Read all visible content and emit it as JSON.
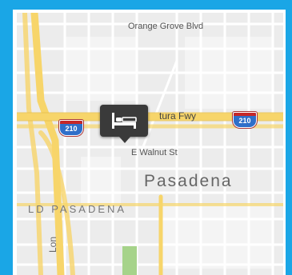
{
  "map": {
    "labels": {
      "orange_grove": "Orange Grove Blvd",
      "freeway": "tura Fwy",
      "walnut": "E Walnut St",
      "city": "Pasadena",
      "district": "LD PASADENA",
      "partial_street": "Lon"
    },
    "shields": [
      {
        "number": "210"
      },
      {
        "number": "210"
      }
    ],
    "marker": {
      "icon": "bed-icon"
    },
    "colors": {
      "frame": "#1aa6e6",
      "land": "#ececec",
      "highway": "#f7d56a",
      "park": "#a6d38a",
      "marker": "#3a3a3a"
    }
  }
}
